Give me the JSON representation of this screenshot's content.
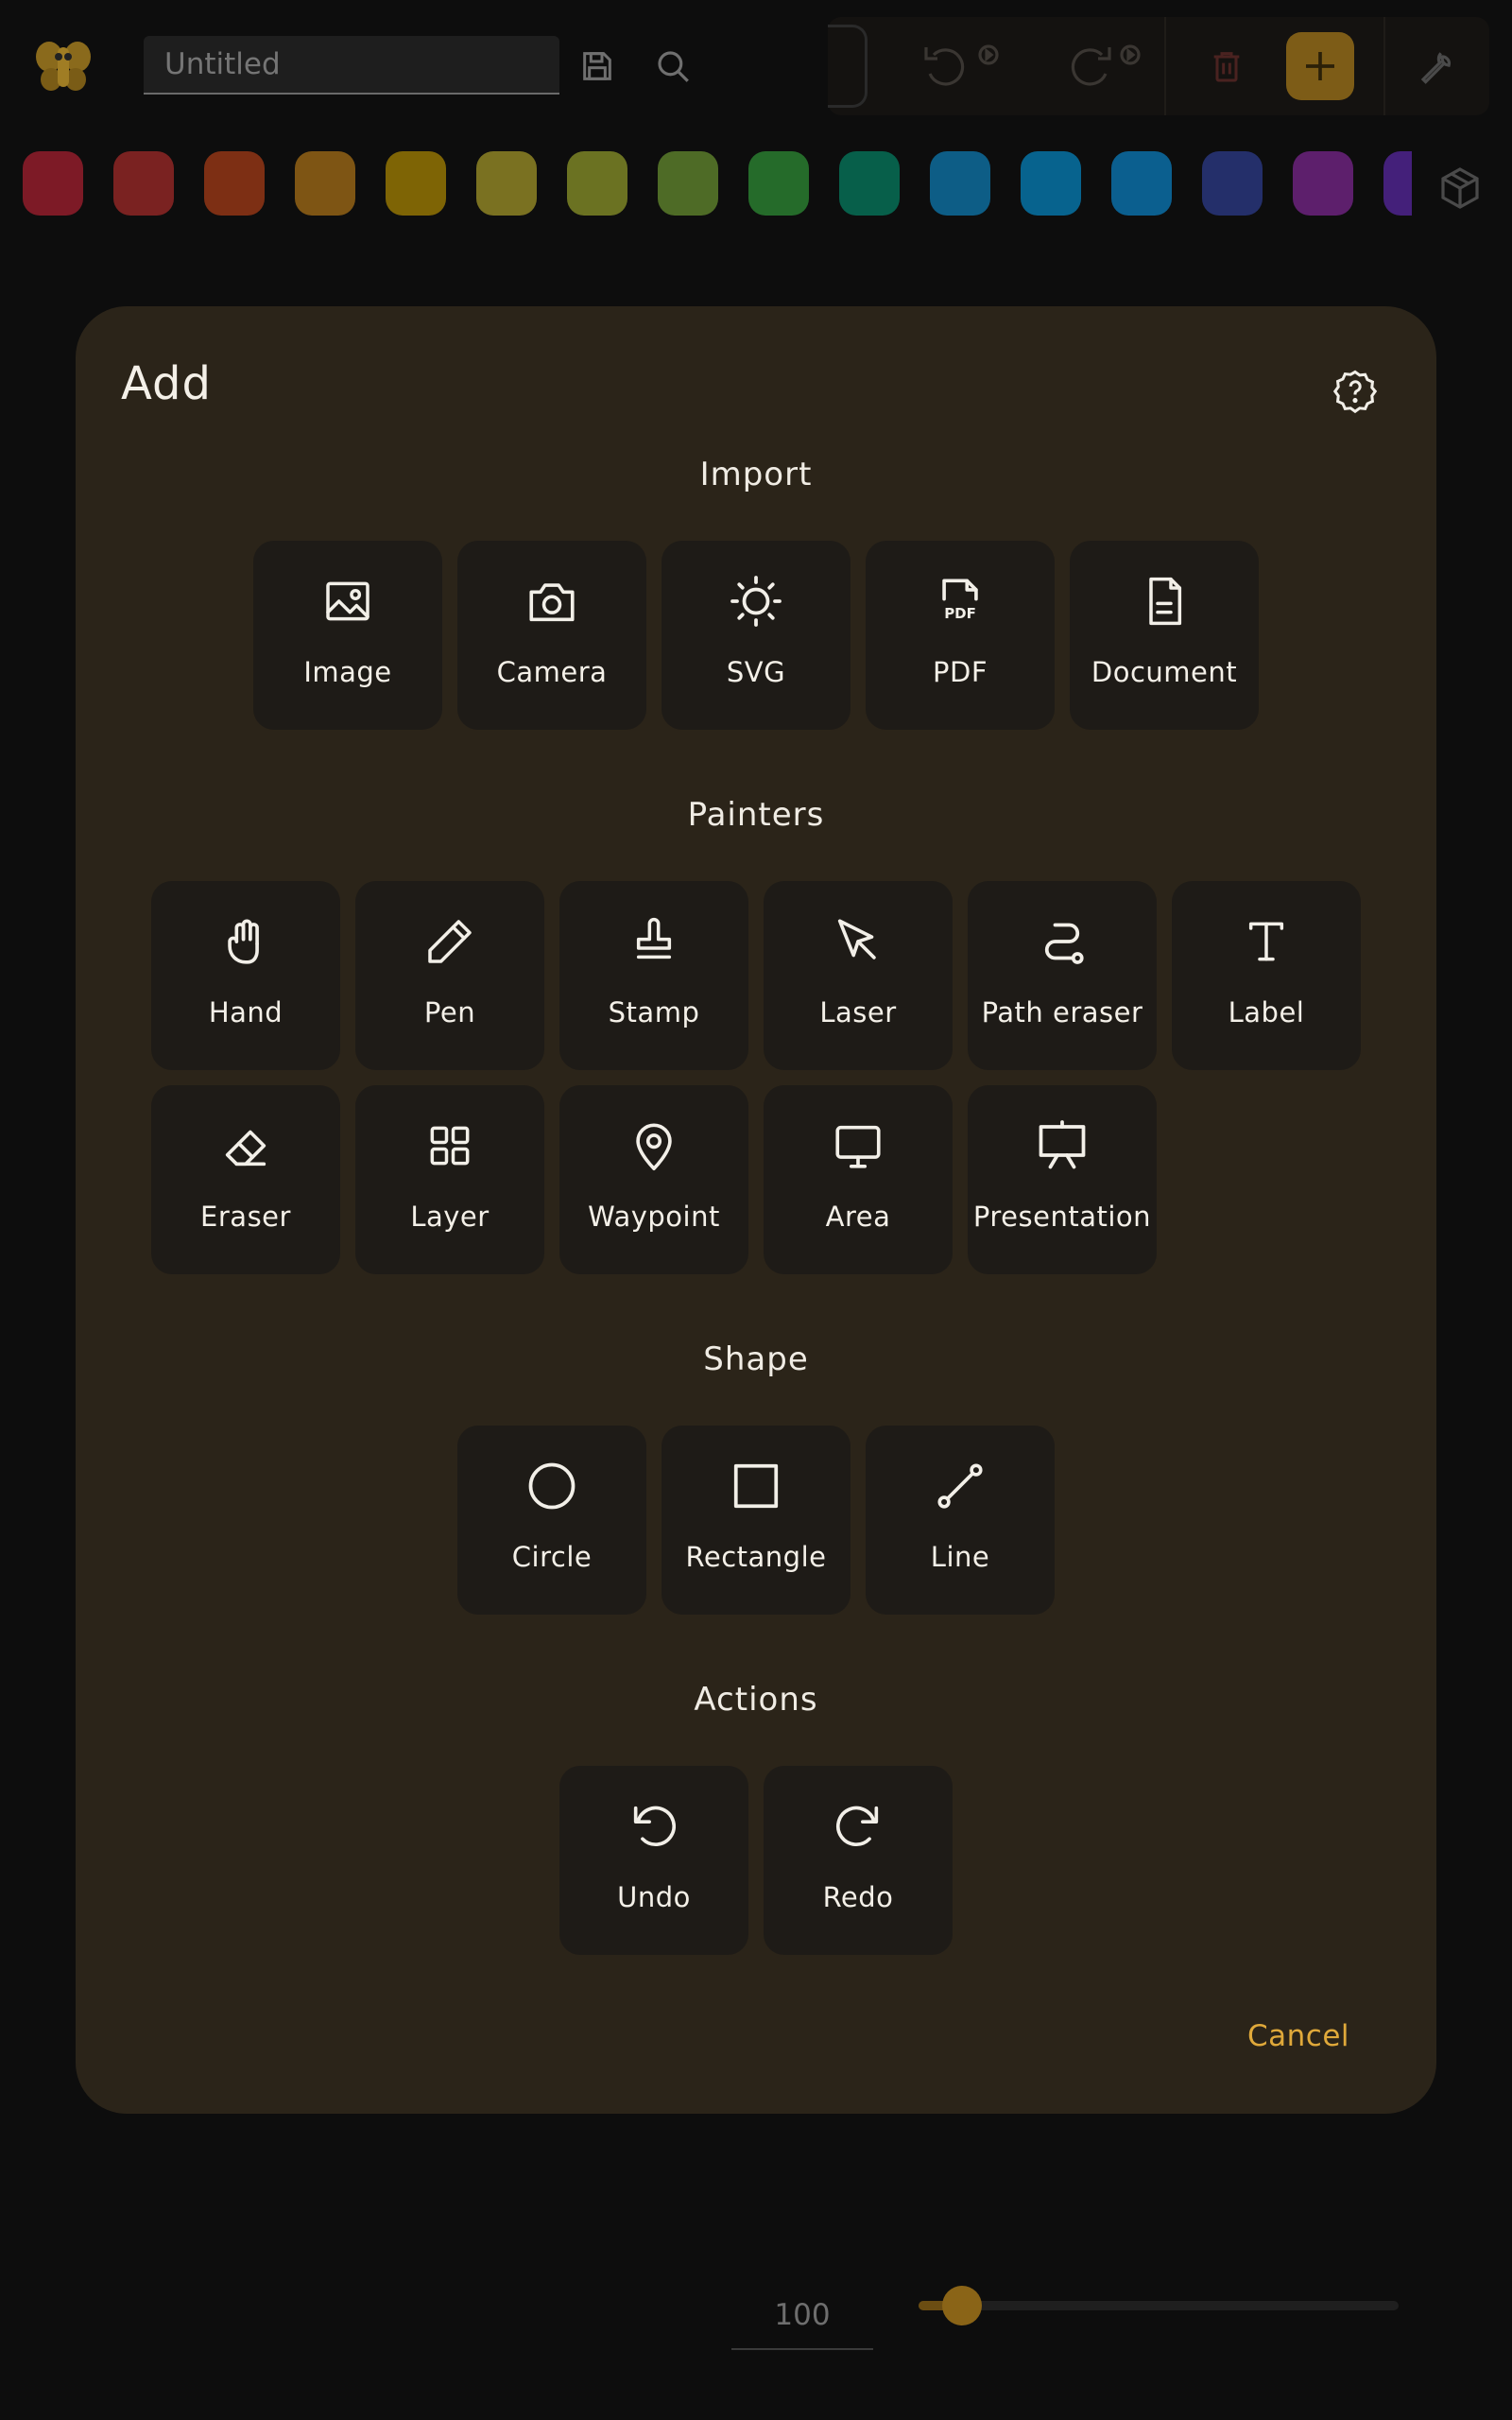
{
  "topbar": {
    "title_placeholder": "Untitled",
    "title_value": ""
  },
  "palette": {
    "colors": [
      "#7d1a26",
      "#7a2221",
      "#7d2f14",
      "#7e5514",
      "#7e6405",
      "#7a7121",
      "#6b7222",
      "#4e6b26",
      "#256b2a",
      "#075f4a",
      "#0d5d86",
      "#07638e",
      "#0b5f8f",
      "#242f6a",
      "#5d1f6c",
      "#44207a"
    ]
  },
  "modal": {
    "title": "Add",
    "sections": {
      "import": {
        "title": "Import",
        "items": [
          {
            "label": "Image",
            "icon": "image-icon"
          },
          {
            "label": "Camera",
            "icon": "camera-icon"
          },
          {
            "label": "SVG",
            "icon": "svg-sun-icon"
          },
          {
            "label": "PDF",
            "icon": "pdf-icon"
          },
          {
            "label": "Document",
            "icon": "document-icon"
          }
        ]
      },
      "painters": {
        "title": "Painters",
        "items": [
          {
            "label": "Hand",
            "icon": "hand-icon"
          },
          {
            "label": "Pen",
            "icon": "pen-icon"
          },
          {
            "label": "Stamp",
            "icon": "stamp-icon"
          },
          {
            "label": "Laser",
            "icon": "cursor-icon"
          },
          {
            "label": "Path eraser",
            "icon": "path-icon"
          },
          {
            "label": "Label",
            "icon": "text-icon"
          },
          {
            "label": "Eraser",
            "icon": "eraser-icon"
          },
          {
            "label": "Layer",
            "icon": "grid-icon"
          },
          {
            "label": "Waypoint",
            "icon": "map-pin-icon"
          },
          {
            "label": "Area",
            "icon": "monitor-icon"
          },
          {
            "label": "Presentation",
            "icon": "presentation-icon"
          }
        ]
      },
      "shape": {
        "title": "Shape",
        "items": [
          {
            "label": "Circle",
            "icon": "circle-icon"
          },
          {
            "label": "Rectangle",
            "icon": "square-icon"
          },
          {
            "label": "Line",
            "icon": "line-icon"
          }
        ]
      },
      "actions": {
        "title": "Actions",
        "items": [
          {
            "label": "Undo",
            "icon": "undo-icon"
          },
          {
            "label": "Redo",
            "icon": "redo-icon"
          }
        ]
      }
    },
    "cancel_label": "Cancel"
  },
  "zoom": {
    "value": "100",
    "slider_fraction": 0.09
  }
}
